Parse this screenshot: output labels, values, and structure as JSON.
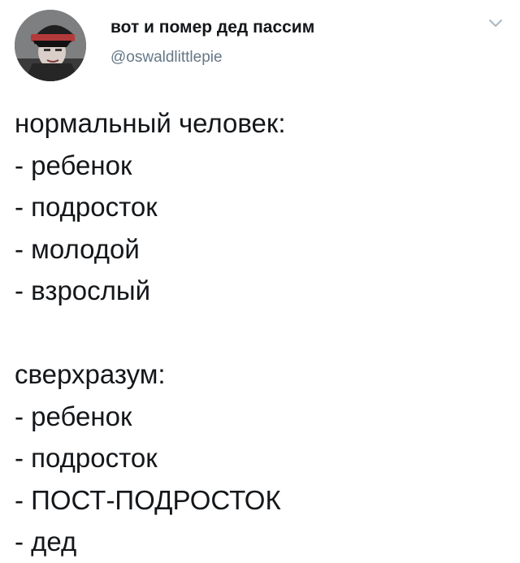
{
  "tweet": {
    "author": {
      "display_name": "вот и помер дед пассим",
      "handle": "@oswaldlittlepie",
      "avatar_icon": "profile-photo-avatar"
    },
    "menu_icon": "chevron-down-icon",
    "text": {
      "section_1": {
        "heading": "нормальный человек:",
        "items": [
          "- ребенок",
          "- подросток",
          "- молодой",
          "- взрослый"
        ]
      },
      "section_2": {
        "heading": "сверхразум:",
        "items": [
          "- ребенок",
          "- подросток",
          "- ПОСТ-ПОДРОСТОК",
          "- дед"
        ]
      }
    }
  },
  "colors": {
    "text": "#14171a",
    "secondary_text": "#657786",
    "background": "#ffffff",
    "chevron": "#aab8c2"
  }
}
